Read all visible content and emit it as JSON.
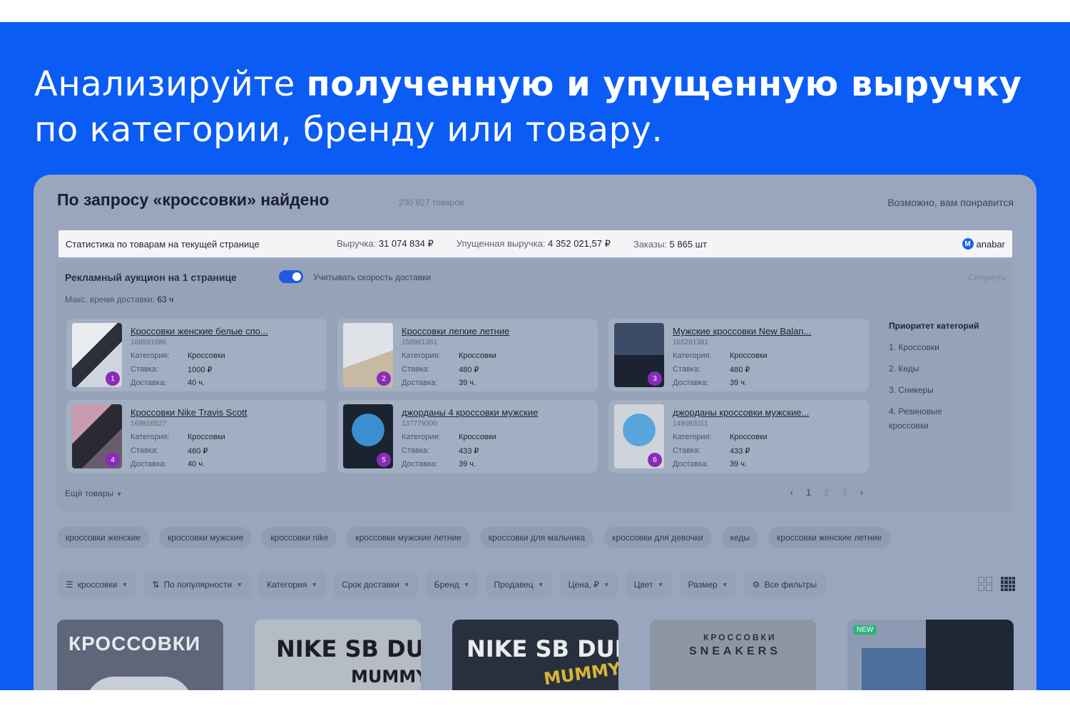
{
  "headline": {
    "part1": "Анализируйте ",
    "bold": "полученную и упущенную выручку",
    "line2": "по категории, бренду или товару."
  },
  "search": {
    "title": "По запросу «кроссовки» найдено",
    "count": "230 927 товаров",
    "maybe_like": "Возможно, вам понравится"
  },
  "stats": {
    "title": "Статистика по товарам на текущей странице",
    "revenue_label": "Выручка: ",
    "revenue_value": "31 074 834 ₽",
    "lost_label": "Упущенная выручка: ",
    "lost_value": "4 352 021,57 ₽",
    "orders_label": "Заказы: ",
    "orders_value": "5 865 шт",
    "brand": "anabar"
  },
  "auction": {
    "title": "Рекламный аукцион на 1 странице",
    "toggle_label": "Учитывать скорость доставки",
    "collapse": "Свернуть",
    "maxtime_label": "Макс. время доставки: ",
    "maxtime_value": "63 ч",
    "row_labels": {
      "category": "Категория:",
      "rate": "Ставка:",
      "delivery": "Доставка:"
    },
    "cards": [
      {
        "num": "1",
        "title": "Кроссовки женские белые спо...",
        "article": "168991686",
        "category": "Кроссовки",
        "rate": "1000 ₽",
        "delivery": "40 ч."
      },
      {
        "num": "2",
        "title": "Кроссовки легкие летние",
        "article": "156961361",
        "category": "Кроссовки",
        "rate": "480 ₽",
        "delivery": "39 ч."
      },
      {
        "num": "3",
        "title": "Мужские кроссовки New Balan...",
        "article": "165281381",
        "category": "Кроссовки",
        "rate": "480 ₽",
        "delivery": "39 ч."
      },
      {
        "num": "4",
        "title": "Кроссовки Nike Travis Scott",
        "article": "169816527",
        "category": "Кроссовки",
        "rate": "460 ₽",
        "delivery": "40 ч."
      },
      {
        "num": "5",
        "title": "джорданы 4 кроссовки мужские",
        "article": "137779300",
        "category": "Кроссовки",
        "rate": "433 ₽",
        "delivery": "39 ч."
      },
      {
        "num": "6",
        "title": "джорданы кроссовки мужские...",
        "article": "149082011",
        "category": "Кроссовки",
        "rate": "433 ₽",
        "delivery": "39 ч."
      }
    ],
    "priority_title": "Приоритет категорий",
    "priority": [
      "1. Кроссовки",
      "2. Кеды",
      "3. Сникеры",
      "4. Резиновые кроссовки"
    ],
    "more": "Ещё товары",
    "pages": [
      "‹",
      "1",
      "2",
      "3",
      "›"
    ]
  },
  "chips": [
    "кроссовки женские",
    "кроссовки мужские",
    "кроссовки nike",
    "кроссовки мужские летние",
    "кроссовки для мальчика",
    "кроссовки для девочки",
    "кеды",
    "кроссовки женские летние"
  ],
  "filters": [
    "кроссовки",
    "По популярности",
    "Категория",
    "Срок доставки",
    "Бренд",
    "Продавец",
    "Цена, ₽",
    "Цвет",
    "Размер",
    "Все фильтры"
  ],
  "products": {
    "p1": "КРОССОВКИ",
    "p2a": "NIKE SB DUNK",
    "p2b": "MUMMY",
    "p3a": "NIKE SB DUNK",
    "p3b": "MUMMY",
    "p4a": "КРОССОВКИ",
    "p4b": "SNEAKERS",
    "p5": "NEW"
  },
  "colors": {
    "accent": "#0a5cf5",
    "badge": "#8a2bb8",
    "toggle": "#1f5be0"
  }
}
